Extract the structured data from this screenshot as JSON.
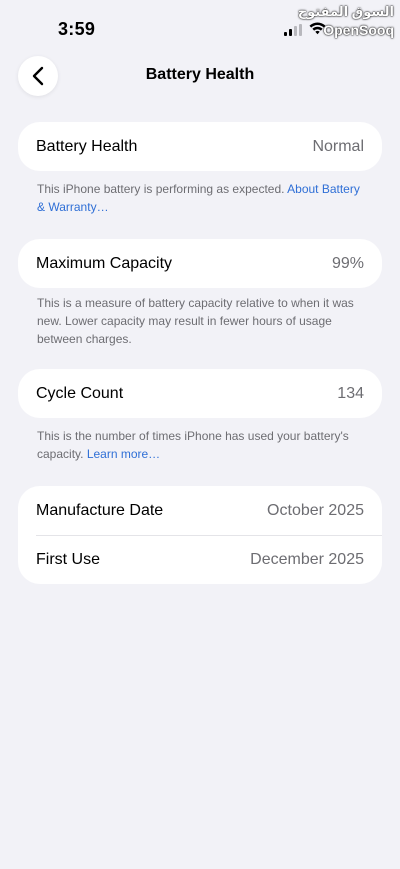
{
  "status_bar": {
    "time": "3:59",
    "watermark_arabic": "السوق المفتوح",
    "watermark_latin": "OpenSooq"
  },
  "nav": {
    "back_icon": "chevron-left-icon",
    "title": "Battery Health"
  },
  "battery_health": {
    "label": "Battery Health",
    "value": "Normal",
    "description": "This iPhone battery is performing as expected.",
    "link": "About Battery & Warranty…"
  },
  "maximum_capacity": {
    "label": "Maximum Capacity",
    "value": "99%",
    "description": "This is a measure of battery capacity relative to when it was new. Lower capacity may result in fewer hours of usage between charges."
  },
  "cycle_count": {
    "label": "Cycle Count",
    "value": "134",
    "description": "This is the number of times iPhone has used your battery's capacity.",
    "link": "Learn more…"
  },
  "dates": {
    "manufacture_label": "Manufacture Date",
    "manufacture_value": "October 2025",
    "first_use_label": "First Use",
    "first_use_value": "December 2025"
  },
  "colors": {
    "background": "#f2f2f7",
    "card": "#ffffff",
    "link": "#2f6fd6",
    "secondary_text": "#6d6d72"
  }
}
